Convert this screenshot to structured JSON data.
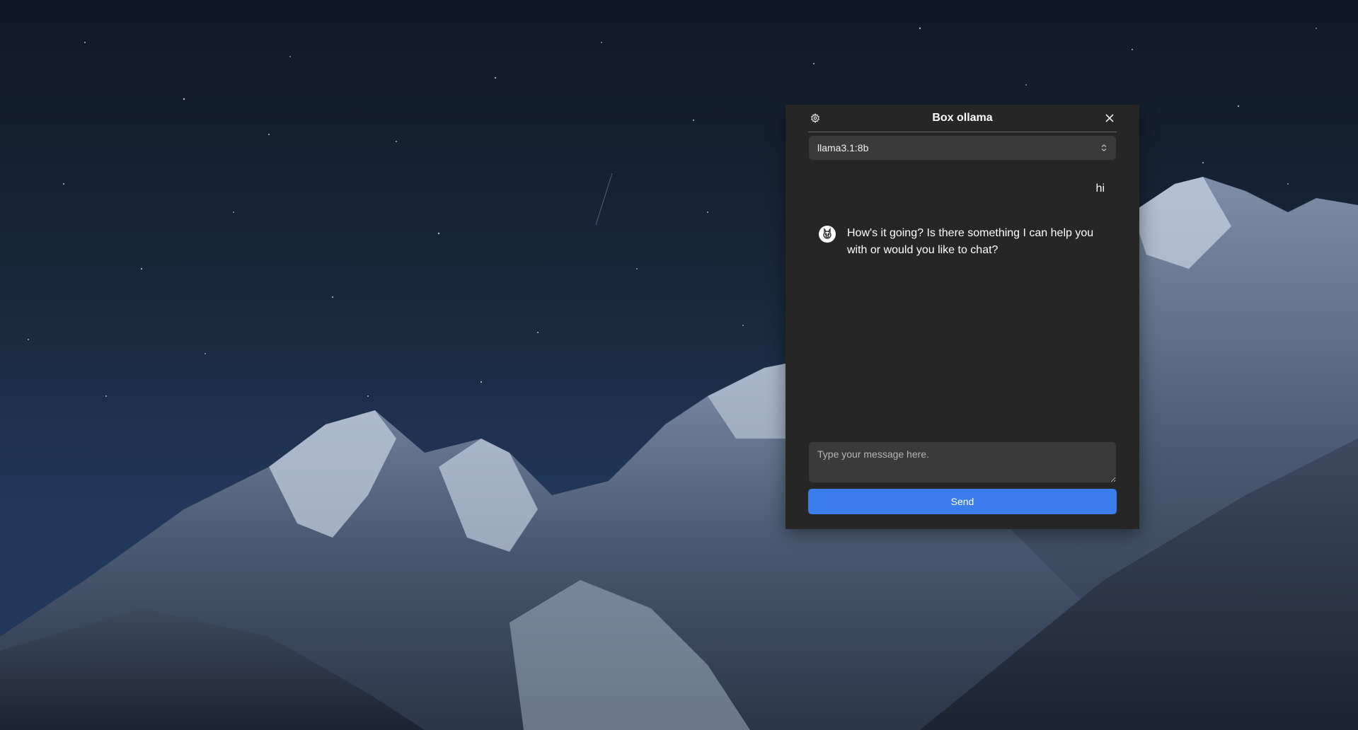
{
  "window": {
    "title": "Box ollama",
    "settings_icon": "gear-icon",
    "close_icon": "close-icon"
  },
  "model_select": {
    "value": "llama3.1:8b",
    "icon": "chevron-up-down-icon"
  },
  "messages": [
    {
      "role": "user",
      "text": "hi"
    },
    {
      "role": "assistant",
      "text": "How's it going? Is there something I can help you with or would you like to chat?",
      "avatar_icon": "llama-avatar-icon"
    }
  ],
  "composer": {
    "placeholder": "Type your message here.",
    "value": "",
    "send_label": "Send"
  },
  "colors": {
    "window_bg": "#262626",
    "field_bg": "#3a3a3a",
    "accent": "#3b7ded"
  }
}
